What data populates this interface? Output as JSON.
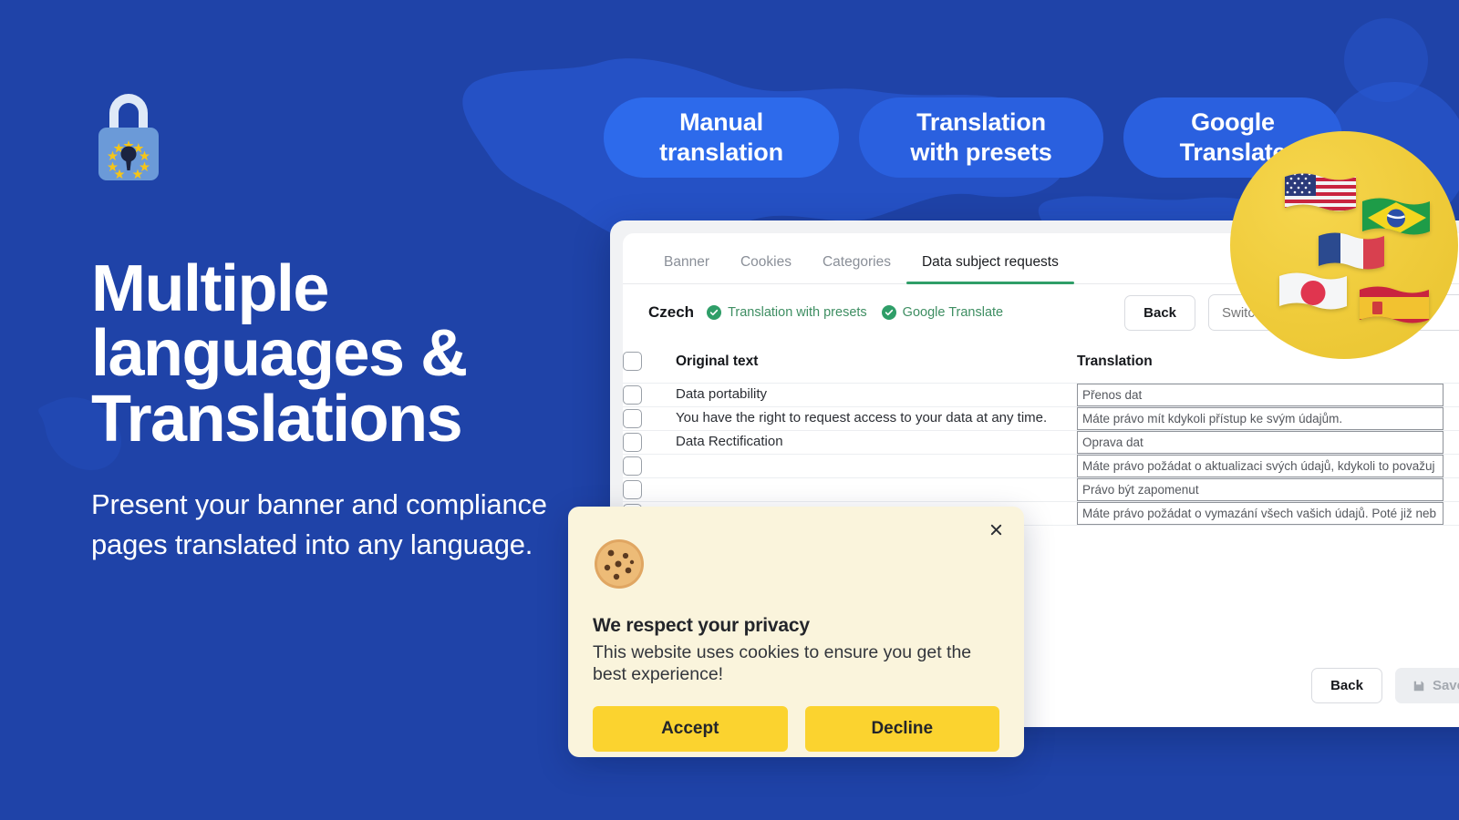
{
  "hero": {
    "title_lines": [
      "Multiple",
      "languages &",
      "Translations"
    ],
    "subtitle": "Present your banner and compliance pages translated into any language.",
    "logo_icon": "gdpr-padlock-icon"
  },
  "pills": [
    {
      "label": "Manual translation",
      "line1": "Manual",
      "line2": "translation"
    },
    {
      "label": "Translation with presets",
      "line1": "Translation",
      "line2": "with presets"
    },
    {
      "label": "Google Translate",
      "line1": "Google",
      "line2": "Translate"
    }
  ],
  "app": {
    "tabs": [
      {
        "label": "Banner",
        "active": false
      },
      {
        "label": "Cookies",
        "active": false
      },
      {
        "label": "Categories",
        "active": false
      },
      {
        "label": "Data subject requests",
        "active": true
      }
    ],
    "language": {
      "name": "Czech",
      "badges": [
        "Translation with presets",
        "Google Translate"
      ]
    },
    "header_actions": {
      "back_label": "Back",
      "switch_placeholder": "Switch destination language"
    },
    "table": {
      "columns": [
        "Original text",
        "Translation"
      ],
      "rows": [
        {
          "original": "Data portability",
          "translation": "Přenos dat"
        },
        {
          "original": "You have the right to request access to your data at any time.",
          "translation": "Máte právo mít kdykoli přístup ke svým údajům."
        },
        {
          "original": "Data Rectification",
          "translation": "Oprava dat"
        },
        {
          "original": "",
          "translation": "Máte právo požádat o aktualizaci svých údajů, kdykoli to považuj"
        },
        {
          "original": "",
          "translation": "Právo být zapomenut"
        },
        {
          "original": "",
          "translation": "Máte právo požádat o vymazání všech vašich údajů. Poté již neb"
        }
      ]
    },
    "footer": {
      "back_label": "Back",
      "save_label": "Save",
      "save_icon": "floppy-disk-icon",
      "save_disabled": true
    }
  },
  "flag_bubble": {
    "flags": [
      "united-states-flag",
      "brazil-flag",
      "france-flag",
      "japan-flag",
      "spain-flag"
    ]
  },
  "cookie_banner": {
    "icon": "cookie-icon",
    "close_icon": "close-icon",
    "title": "We respect your privacy",
    "text": "This website uses cookies to ensure you get the best experience!",
    "accept_label": "Accept",
    "decline_label": "Decline"
  },
  "colors": {
    "background_blue": "#1f43a8",
    "map_blue": "#2a5bd7",
    "pill_blue": "#2a66e8",
    "accent_green": "#2f9e68",
    "bubble_yellow": "#efcb3a",
    "cookie_cream": "#faf4dc",
    "cookie_button_yellow": "#fbd32f"
  }
}
